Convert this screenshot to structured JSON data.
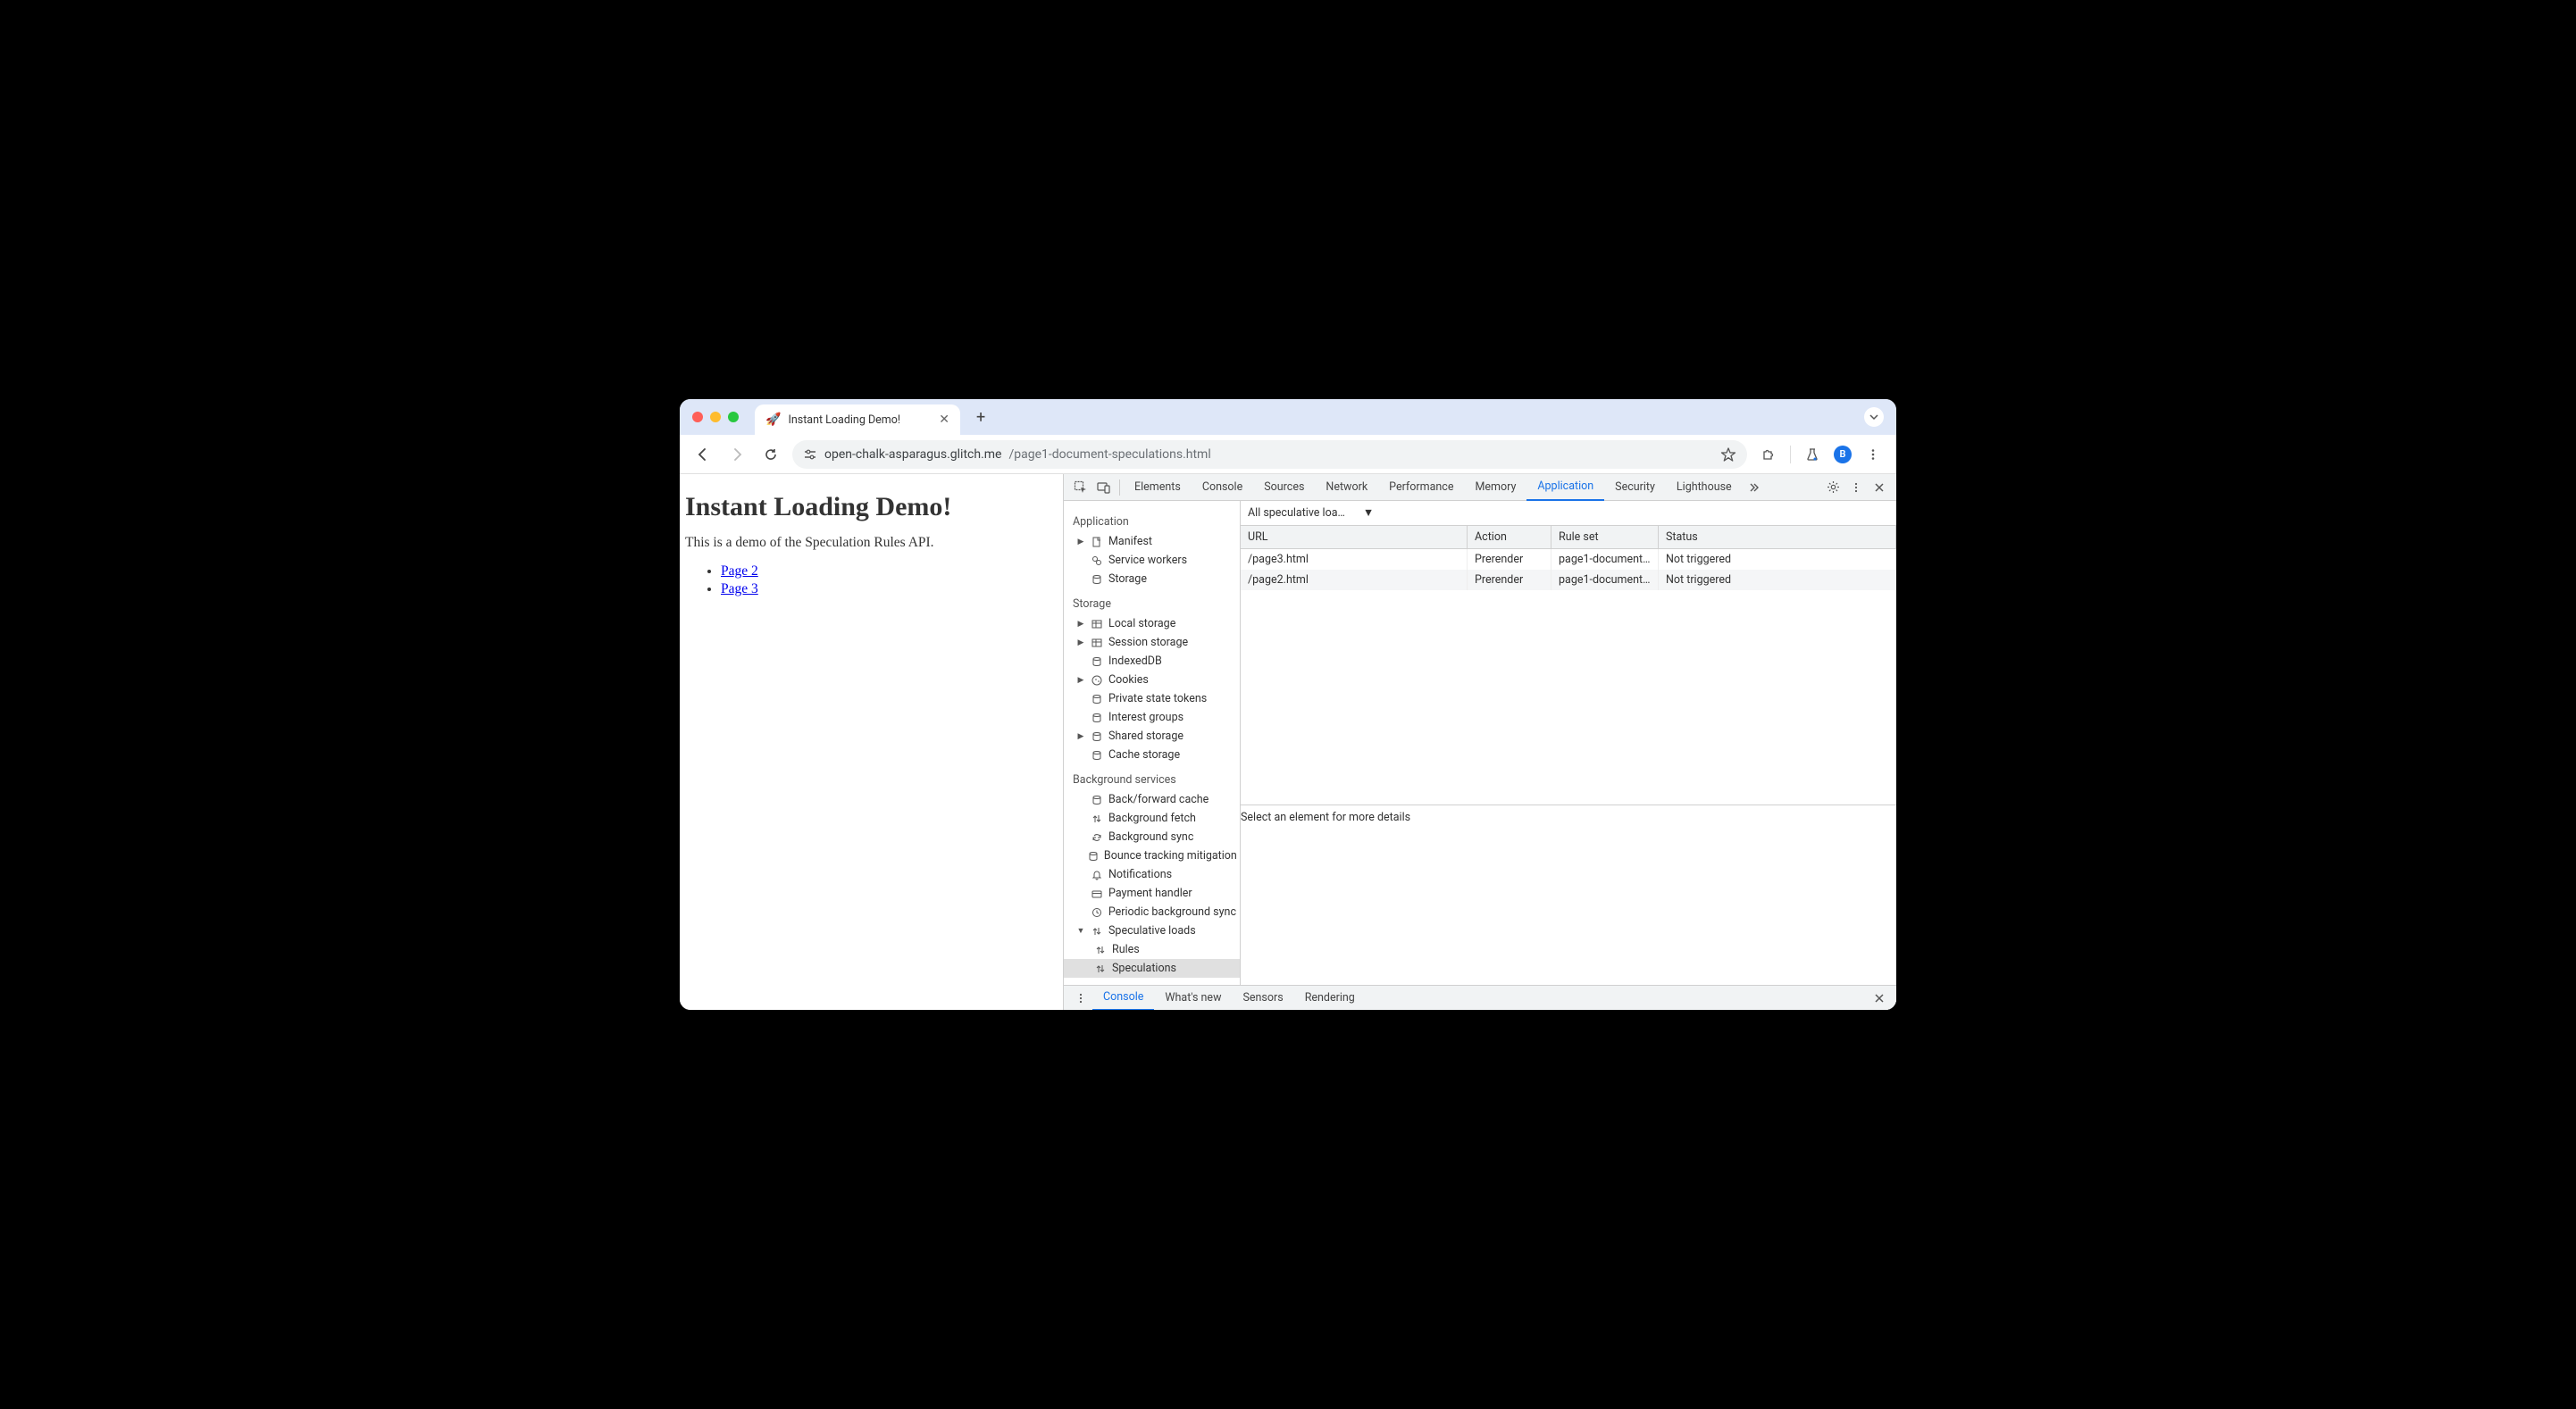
{
  "tab": {
    "favicon": "🚀",
    "title": "Instant Loading Demo!"
  },
  "url": {
    "host": "open-chalk-asparagus.glitch.me",
    "path": "/page1-document-speculations.html"
  },
  "avatar_letter": "B",
  "page": {
    "heading": "Instant Loading Demo!",
    "intro": "This is a demo of the Speculation Rules API.",
    "links": [
      {
        "text": "Page 2"
      },
      {
        "text": "Page 3"
      }
    ]
  },
  "devtools_tabs": {
    "elements": "Elements",
    "console": "Console",
    "sources": "Sources",
    "network": "Network",
    "performance": "Performance",
    "memory": "Memory",
    "application": "Application",
    "security": "Security",
    "lighthouse": "Lighthouse"
  },
  "sidebar": {
    "sections": {
      "application": "Application",
      "storage": "Storage",
      "background": "Background services"
    },
    "application_items": {
      "manifest": "Manifest",
      "service_workers": "Service workers",
      "storage": "Storage"
    },
    "storage_items": {
      "local_storage": "Local storage",
      "session_storage": "Session storage",
      "indexeddb": "IndexedDB",
      "cookies": "Cookies",
      "private_state_tokens": "Private state tokens",
      "interest_groups": "Interest groups",
      "shared_storage": "Shared storage",
      "cache_storage": "Cache storage"
    },
    "bg_items": {
      "bf_cache": "Back/forward cache",
      "bg_fetch": "Background fetch",
      "bg_sync": "Background sync",
      "bounce_tracking": "Bounce tracking mitigation",
      "notifications": "Notifications",
      "payment_handler": "Payment handler",
      "periodic_bg_sync": "Periodic background sync",
      "speculative_loads": "Speculative loads",
      "rules": "Rules",
      "speculations": "Speculations"
    }
  },
  "content": {
    "dropdown_label": "All speculative loa…",
    "columns": {
      "url": "URL",
      "action": "Action",
      "ruleset": "Rule set",
      "status": "Status"
    },
    "rows": [
      {
        "url": "/page3.html",
        "action": "Prerender",
        "ruleset": "page1-document-…",
        "status": "Not triggered"
      },
      {
        "url": "/page2.html",
        "action": "Prerender",
        "ruleset": "page1-document-…",
        "status": "Not triggered"
      }
    ],
    "detail_hint": "Select an element for more details"
  },
  "drawer": {
    "console": "Console",
    "whats_new": "What's new",
    "sensors": "Sensors",
    "rendering": "Rendering"
  }
}
